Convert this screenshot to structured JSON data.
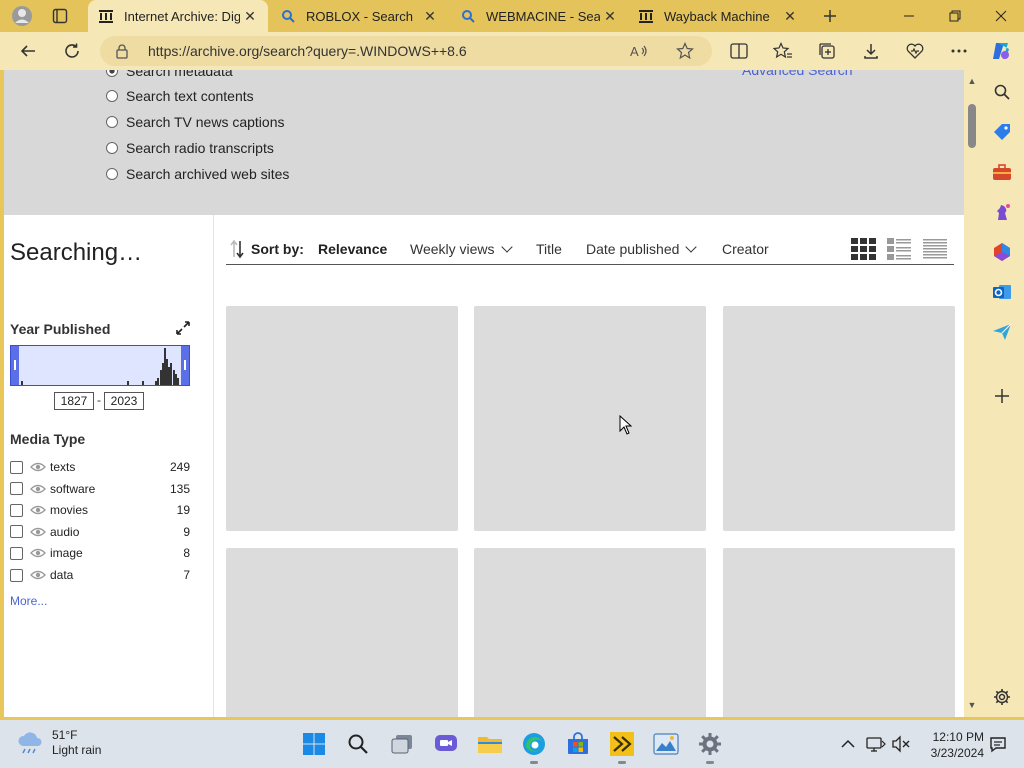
{
  "browser": {
    "tabs": [
      {
        "label": "Internet Archive: Digi",
        "favicon": "archive-icon",
        "active": true
      },
      {
        "label": "ROBLOX - Search",
        "favicon": "search-icon",
        "active": false
      },
      {
        "label": "WEBMACINE - Search",
        "favicon": "search-icon",
        "active": false
      },
      {
        "label": "Wayback Machine",
        "favicon": "archive-icon",
        "active": false
      }
    ],
    "url": "https://archive.org/search?query=.WINDOWS++8.6"
  },
  "search_options": {
    "radios": [
      {
        "label": "Search metadata",
        "checked": true
      },
      {
        "label": "Search text contents",
        "checked": false
      },
      {
        "label": "Search TV news captions",
        "checked": false
      },
      {
        "label": "Search radio transcripts",
        "checked": false
      },
      {
        "label": "Search archived web sites",
        "checked": false
      }
    ],
    "advanced_link": "Advanced Search"
  },
  "sidebar": {
    "status": "Searching…",
    "year_published": {
      "heading": "Year Published",
      "min_year": "1827",
      "max_year": "2023",
      "separator": "-",
      "histogram": [
        1,
        0,
        0,
        0,
        0,
        0,
        0,
        0,
        0,
        0,
        0,
        0,
        0,
        0,
        0,
        0,
        0,
        0,
        0,
        0,
        0,
        0,
        0,
        0,
        0,
        0,
        0,
        0,
        0,
        0,
        0,
        0,
        0,
        0,
        0,
        0,
        0,
        0,
        0,
        0,
        0,
        0,
        0,
        0,
        0,
        0,
        0,
        0,
        0,
        1,
        0,
        0,
        0,
        0,
        0,
        0,
        1,
        0,
        0,
        0,
        0,
        0,
        1,
        2,
        4,
        6,
        10,
        7,
        5,
        6,
        4,
        3,
        2
      ]
    },
    "media_type": {
      "heading": "Media Type",
      "items": [
        {
          "name": "texts",
          "count": "249"
        },
        {
          "name": "software",
          "count": "135"
        },
        {
          "name": "movies",
          "count": "19"
        },
        {
          "name": "audio",
          "count": "9"
        },
        {
          "name": "image",
          "count": "8"
        },
        {
          "name": "data",
          "count": "7"
        }
      ],
      "more": "More..."
    }
  },
  "sort": {
    "label": "Sort by:",
    "options": [
      "Relevance",
      "Weekly views",
      "Title",
      "Date published",
      "Creator"
    ],
    "active": "Relevance"
  },
  "weather": {
    "temp": "51°F",
    "condition": "Light rain"
  },
  "clock": {
    "time": "12:10 PM",
    "date": "3/23/2024"
  }
}
